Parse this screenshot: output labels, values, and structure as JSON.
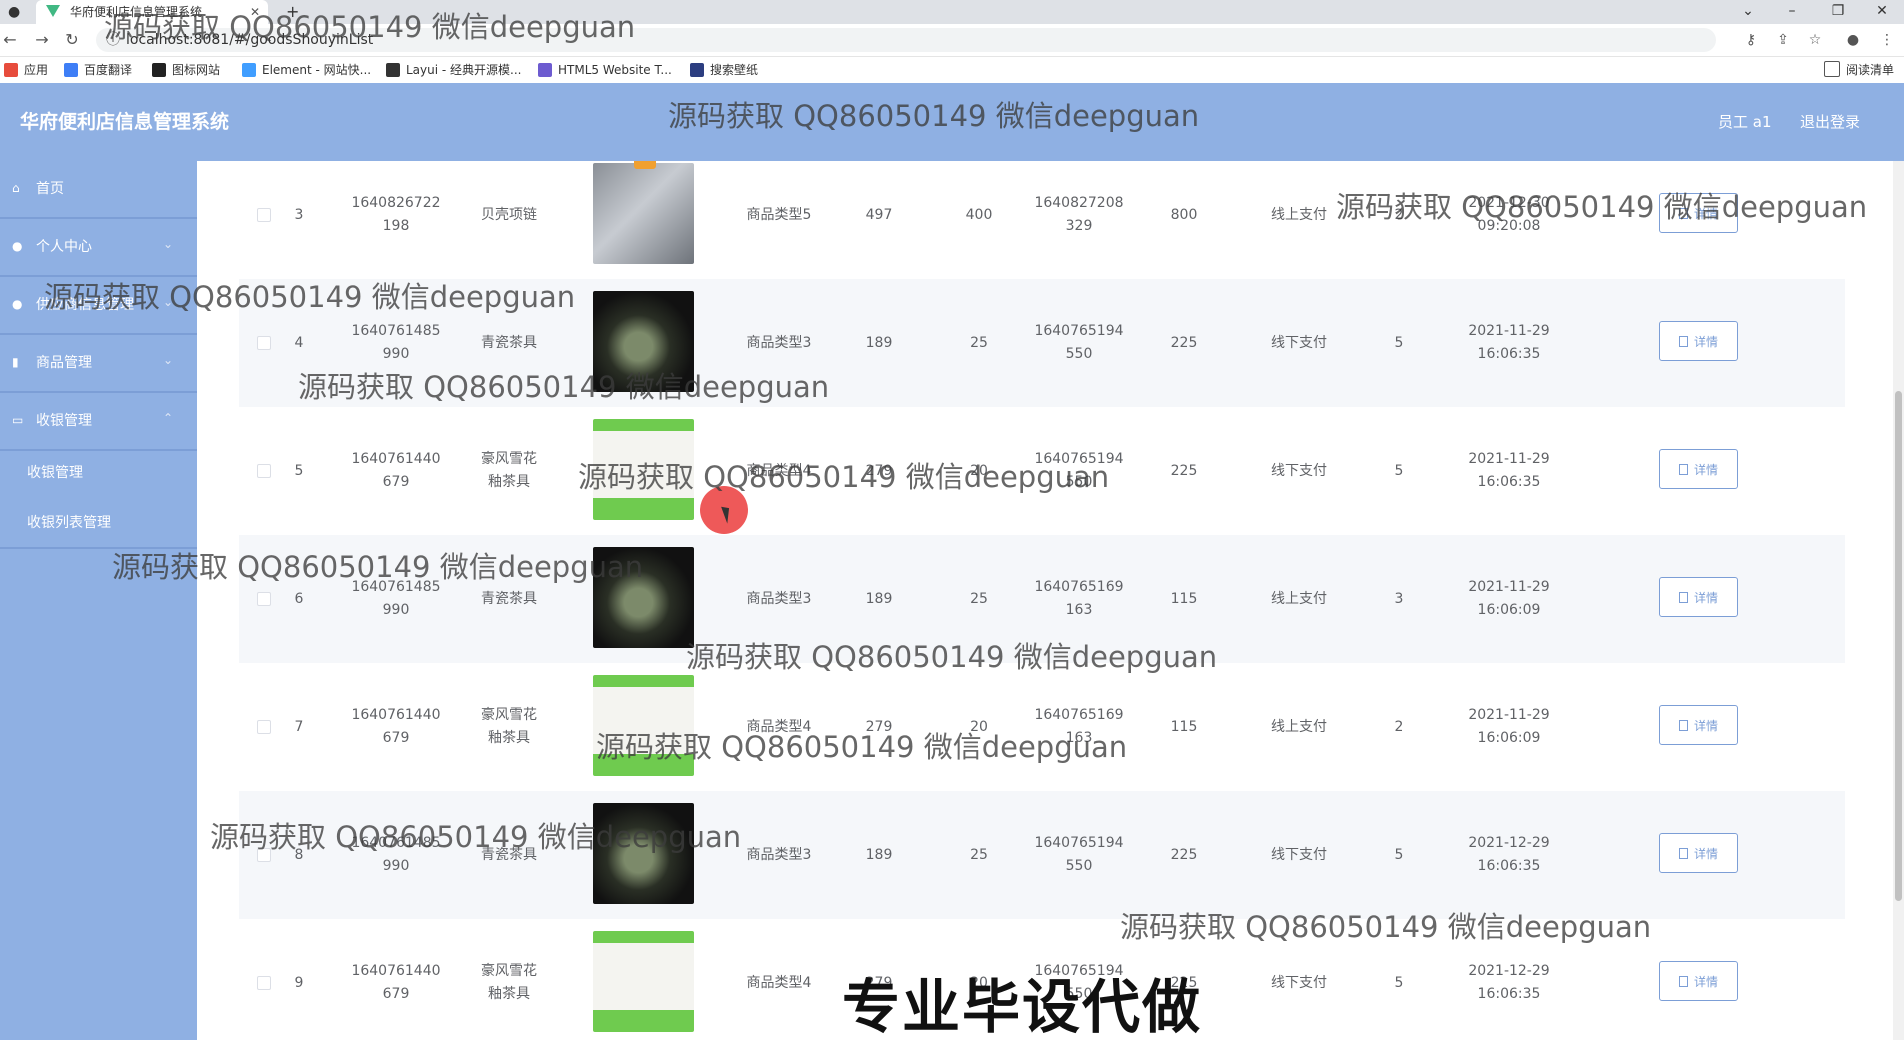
{
  "browser": {
    "tab_title": "华府便利店信息管理系统",
    "url": "localhost:8081/#/goodsShouyinList",
    "bookmarks": [
      {
        "label": "应用",
        "color": "#e74c3c"
      },
      {
        "label": "百度翻译",
        "color": "#3e7ef6"
      },
      {
        "label": "图标网站",
        "color": "#222222"
      },
      {
        "label": "Element - 网站快...",
        "color": "#409eff"
      },
      {
        "label": "Layui - 经典开源模...",
        "color": "#333333"
      },
      {
        "label": "HTML5 Website T...",
        "color": "#6d5bd0"
      },
      {
        "label": "搜索壁纸",
        "color": "#2c3e80"
      }
    ],
    "reading_list": "阅读清单"
  },
  "header": {
    "title": "华府便利店信息管理系统",
    "user": "员工 a1",
    "logout": "退出登录"
  },
  "sidebar": {
    "items": [
      {
        "label": "首页",
        "icon": "home-icon"
      },
      {
        "label": "个人中心",
        "icon": "user-icon"
      },
      {
        "label": "供应商信息管理",
        "icon": "user-icon"
      },
      {
        "label": "商品管理",
        "icon": "chart-icon"
      },
      {
        "label": "收银管理",
        "icon": "list-icon"
      }
    ],
    "submenu": [
      "收银管理",
      "收银列表管理"
    ]
  },
  "table": {
    "detail_label": "详情",
    "rows": [
      {
        "index": "3",
        "id": "1640826722198",
        "name": "贝壳项链",
        "category": "商品类型5",
        "price": "497",
        "qty": "400",
        "order": "1640827208329",
        "total": "800",
        "pay": "线上支付",
        "count": "2",
        "time": "2021-12-30 09:20:08",
        "img": "necklace"
      },
      {
        "index": "4",
        "id": "1640761485990",
        "name": "青瓷茶具",
        "category": "商品类型3",
        "price": "189",
        "qty": "25",
        "order": "1640765194550",
        "total": "225",
        "pay": "线下支付",
        "count": "5",
        "time": "2021-11-29 16:06:35",
        "img": "dark"
      },
      {
        "index": "5",
        "id": "1640761440679",
        "name": "豪风雪花釉茶具",
        "category": "商品类型4",
        "price": "279",
        "qty": "20",
        "order": "1640765194550",
        "total": "225",
        "pay": "线下支付",
        "count": "5",
        "time": "2021-11-29 16:06:35",
        "img": "light"
      },
      {
        "index": "6",
        "id": "1640761485990",
        "name": "青瓷茶具",
        "category": "商品类型3",
        "price": "189",
        "qty": "25",
        "order": "1640765169163",
        "total": "115",
        "pay": "线上支付",
        "count": "3",
        "time": "2021-11-29 16:06:09",
        "img": "dark"
      },
      {
        "index": "7",
        "id": "1640761440679",
        "name": "豪风雪花釉茶具",
        "category": "商品类型4",
        "price": "279",
        "qty": "20",
        "order": "1640765169163",
        "total": "115",
        "pay": "线上支付",
        "count": "2",
        "time": "2021-11-29 16:06:09",
        "img": "light"
      },
      {
        "index": "8",
        "id": "1640761485990",
        "name": "青瓷茶具",
        "category": "商品类型3",
        "price": "189",
        "qty": "25",
        "order": "1640765194550",
        "total": "225",
        "pay": "线下支付",
        "count": "5",
        "time": "2021-12-29 16:06:35",
        "img": "dark"
      },
      {
        "index": "9",
        "id": "1640761440679",
        "name": "豪风雪花釉茶具",
        "category": "商品类型4",
        "price": "279",
        "qty": "20",
        "order": "1640765194550",
        "total": "225",
        "pay": "线下支付",
        "count": "5",
        "time": "2021-12-29 16:06:35",
        "img": "light"
      }
    ]
  },
  "overlays": {
    "watermark": "源码获取 QQ86050149 微信deepguan",
    "banner": "专业毕设代做"
  }
}
